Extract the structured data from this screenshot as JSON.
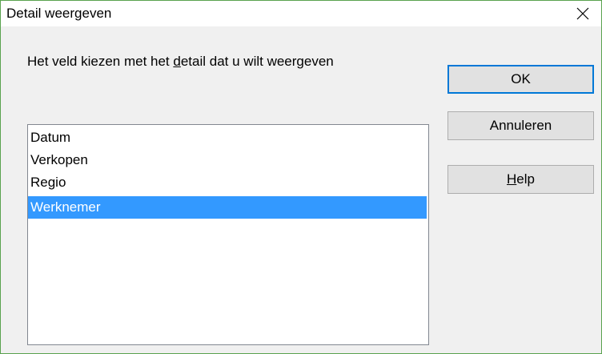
{
  "dialog": {
    "title": "Detail weergeven",
    "close_icon": "close-icon"
  },
  "prompt": {
    "before": "Het veld kiezen met het ",
    "mnemonic": "d",
    "after": "etail dat u wilt weergeven"
  },
  "list": {
    "items": [
      "Datum",
      "Verkopen",
      "Regio",
      "Werknemer"
    ],
    "selected": "Werknemer"
  },
  "buttons": {
    "ok": "OK",
    "cancel": "Annuleren",
    "help_mnemonic": "H",
    "help_rest": "elp"
  },
  "colors": {
    "selection": "#3399ff",
    "default_button_border": "#0078d7",
    "window_border": "#5aa34f"
  }
}
